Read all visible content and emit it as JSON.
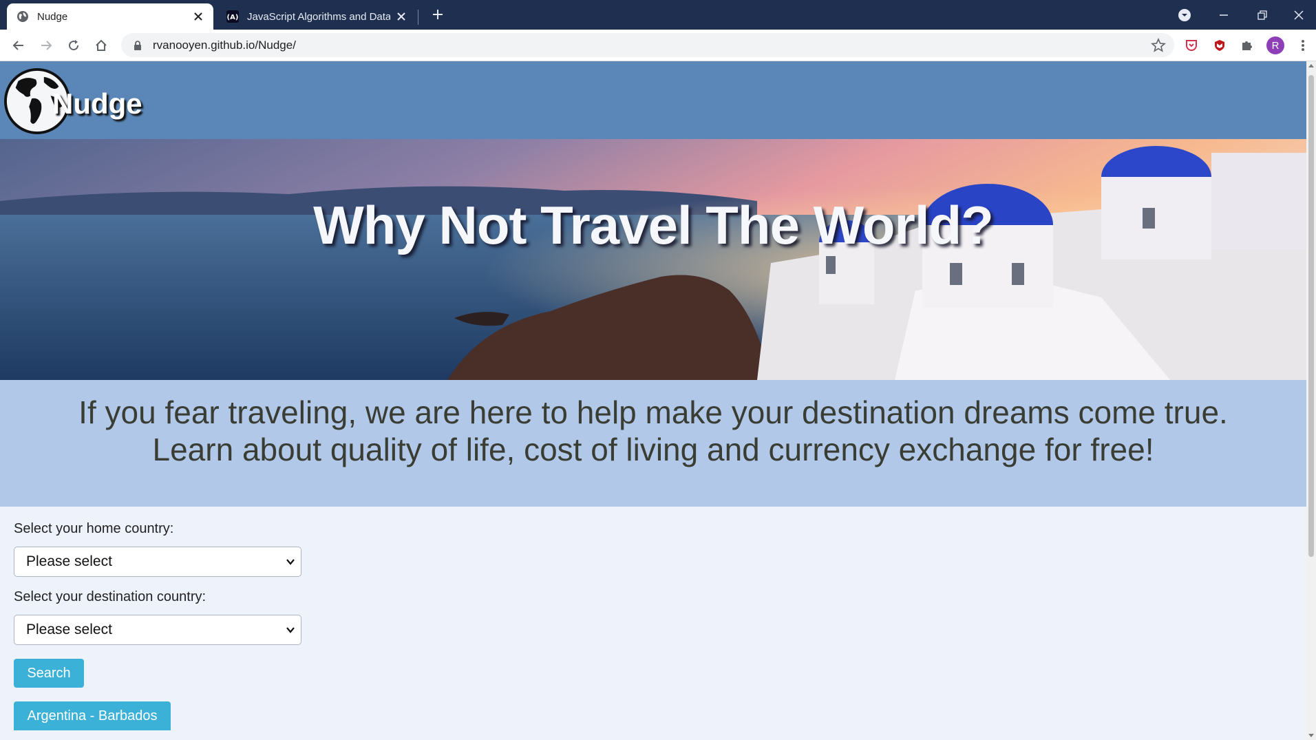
{
  "browser": {
    "tabs": [
      {
        "title": "Nudge",
        "active": true
      },
      {
        "title": "JavaScript Algorithms and Data S",
        "active": false
      }
    ],
    "url": "rvanooyen.github.io/Nudge/",
    "profile_initial": "R"
  },
  "site": {
    "logo_text": "Nudge",
    "hero_title": "Why Not Travel The World?",
    "tagline_line1": "If you fear traveling, we are here to help make your destination dreams come true.",
    "tagline_line2": "Learn about quality of life, cost of living and currency exchange for free!"
  },
  "form": {
    "home_label": "Select your home country:",
    "home_value": "Please select",
    "dest_label": "Select your destination country:",
    "dest_value": "Please select",
    "search_label": "Search",
    "history_button": "Argentina - Barbados"
  },
  "colors": {
    "header_bg": "#5a87b8",
    "tagline_bg": "#b1c8e8",
    "button_bg": "#3cb1d7",
    "page_bg": "#eef2fb"
  }
}
